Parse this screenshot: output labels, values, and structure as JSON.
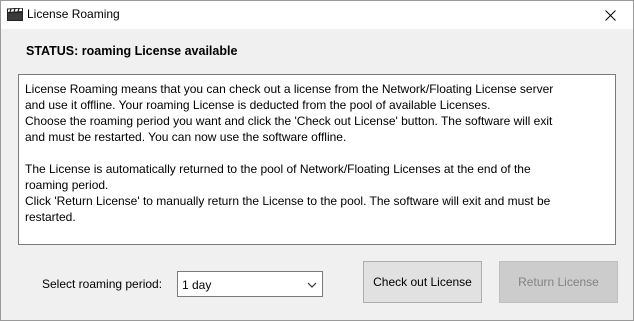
{
  "window": {
    "title": "License Roaming",
    "app_icon": "clapperboard-icon",
    "close_icon": "close-icon"
  },
  "status": {
    "text": "STATUS: roaming License available"
  },
  "info": {
    "line1": "License Roaming means that you can check out a license from the Network/Floating License server",
    "line2": "and use it offline. Your roaming License is deducted from the pool of available Licenses.",
    "line3": "Choose the roaming period you want and click the 'Check out License' button. The software will exit",
    "line4": "and must be restarted. You can now use the software offline.",
    "line5": "The License is automatically returned to the pool of Network/Floating Licenses at the end of the",
    "line6": "roaming period.",
    "line7": "Click 'Return License' to manually return the License to the pool. The software will exit and must be",
    "line8": "restarted."
  },
  "period": {
    "label": "Select roaming period:",
    "selected": "1 day",
    "chevron_icon": "chevron-down-icon"
  },
  "buttons": {
    "checkout": "Check out License",
    "return": "Return License",
    "return_disabled": true
  }
}
